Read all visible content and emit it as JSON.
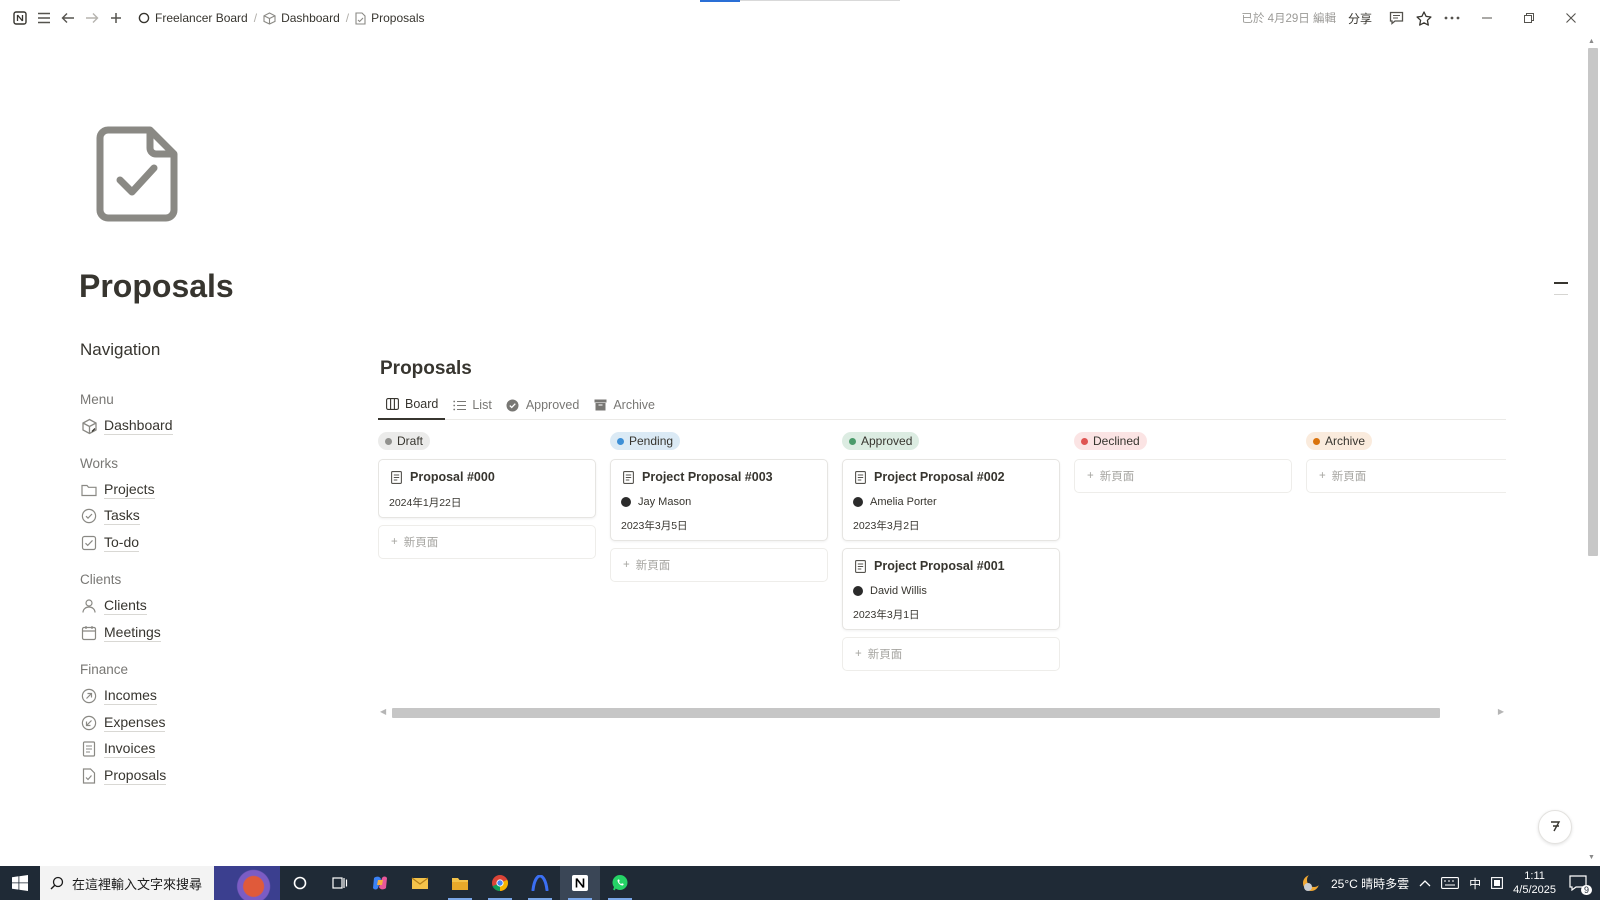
{
  "topbar": {
    "breadcrumbs": [
      "Freelancer Board",
      "Dashboard",
      "Proposals"
    ],
    "edited": "已於 4月29日 編輯",
    "share": "分享"
  },
  "page": {
    "title": "Proposals",
    "icon": "document-check-icon"
  },
  "navigation": {
    "heading": "Navigation",
    "sections": [
      {
        "title": "Menu",
        "items": [
          {
            "label": "Dashboard",
            "icon": "cube-icon"
          }
        ]
      },
      {
        "title": "Works",
        "items": [
          {
            "label": "Projects",
            "icon": "folder-icon"
          },
          {
            "label": "Tasks",
            "icon": "check-circle-icon"
          },
          {
            "label": "To-do",
            "icon": "checkbox-icon"
          }
        ]
      },
      {
        "title": "Clients",
        "items": [
          {
            "label": "Clients",
            "icon": "person-icon"
          },
          {
            "label": "Meetings",
            "icon": "calendar-icon"
          }
        ]
      },
      {
        "title": "Finance",
        "items": [
          {
            "label": "Incomes",
            "icon": "arrow-up-circle-icon"
          },
          {
            "label": "Expenses",
            "icon": "arrow-down-circle-icon"
          },
          {
            "label": "Invoices",
            "icon": "receipt-icon"
          },
          {
            "label": "Proposals",
            "icon": "document-check-icon"
          }
        ]
      }
    ]
  },
  "database": {
    "title": "Proposals",
    "views": [
      {
        "label": "Board",
        "icon": "board-icon",
        "active": true
      },
      {
        "label": "List",
        "icon": "list-icon",
        "active": false
      },
      {
        "label": "Approved",
        "icon": "check-filled-icon",
        "active": false
      },
      {
        "label": "Archive",
        "icon": "archive-icon",
        "active": false
      }
    ],
    "new_page_label": "新頁面",
    "columns": [
      {
        "name": "Draft",
        "pill_bg": "#ebebea",
        "dot": "#91918e",
        "cards": [
          {
            "title": "Proposal #000",
            "person": "",
            "date": "2024年1月22日"
          }
        ]
      },
      {
        "name": "Pending",
        "pill_bg": "#dbeaf5",
        "dot": "#3d8fd6",
        "cards": [
          {
            "title": "Project Proposal #003",
            "person": "Jay Mason",
            "date": "2023年3月5日"
          }
        ]
      },
      {
        "name": "Approved",
        "pill_bg": "#dcece2",
        "dot": "#4a9a6a",
        "cards": [
          {
            "title": "Project Proposal #002",
            "person": "Amelia Porter",
            "date": "2023年3月2日"
          },
          {
            "title": "Project Proposal #001",
            "person": "David Willis",
            "date": "2023年3月1日"
          }
        ]
      },
      {
        "name": "Declined",
        "pill_bg": "#fbe4e4",
        "dot": "#df5452",
        "cards": []
      },
      {
        "name": "Archive",
        "pill_bg": "#faebdd",
        "dot": "#d9730d",
        "cards": []
      }
    ]
  },
  "taskbar": {
    "search_placeholder": "在這裡輸入文字來搜尋",
    "weather": "25°C  晴時多雲",
    "ime": "中",
    "time": "1:11",
    "date": "4/5/2025",
    "notifications": "9"
  }
}
